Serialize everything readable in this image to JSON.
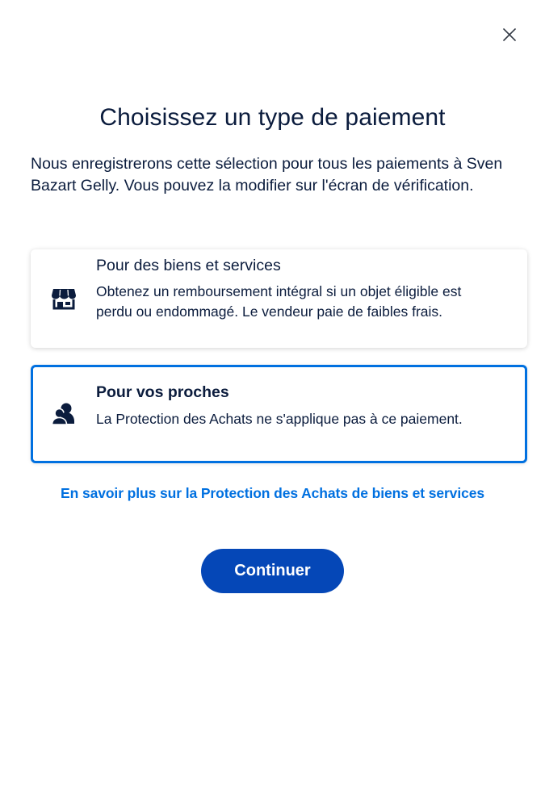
{
  "dialog": {
    "close_label": "",
    "title": "Choisissez un type de paiement",
    "intro": "Nous enregistrerons cette sélection pour tous les paiements à Sven Bazart Gelly. Vous pouvez la modifier sur l'écran de vérification."
  },
  "options": [
    {
      "icon": "store-icon",
      "title": "Pour des biens et services",
      "description": "Obtenez un remboursement intégral si un objet éligible est perdu ou endommagé. Le vendeur paie de faibles frais.",
      "selected": false
    },
    {
      "icon": "person-icon",
      "title": "Pour vos proches",
      "description": "La Protection des Achats ne s'applique pas à ce paiement.",
      "selected": true
    }
  ],
  "learn_more_link": "En savoir plus sur la Protection des Achats de biens et services",
  "continue_button": "Continuer",
  "colors": {
    "primary_button": "#0547b7",
    "link": "#0070e0",
    "selected_border": "#0070e0",
    "text": "#0b1c3d"
  }
}
